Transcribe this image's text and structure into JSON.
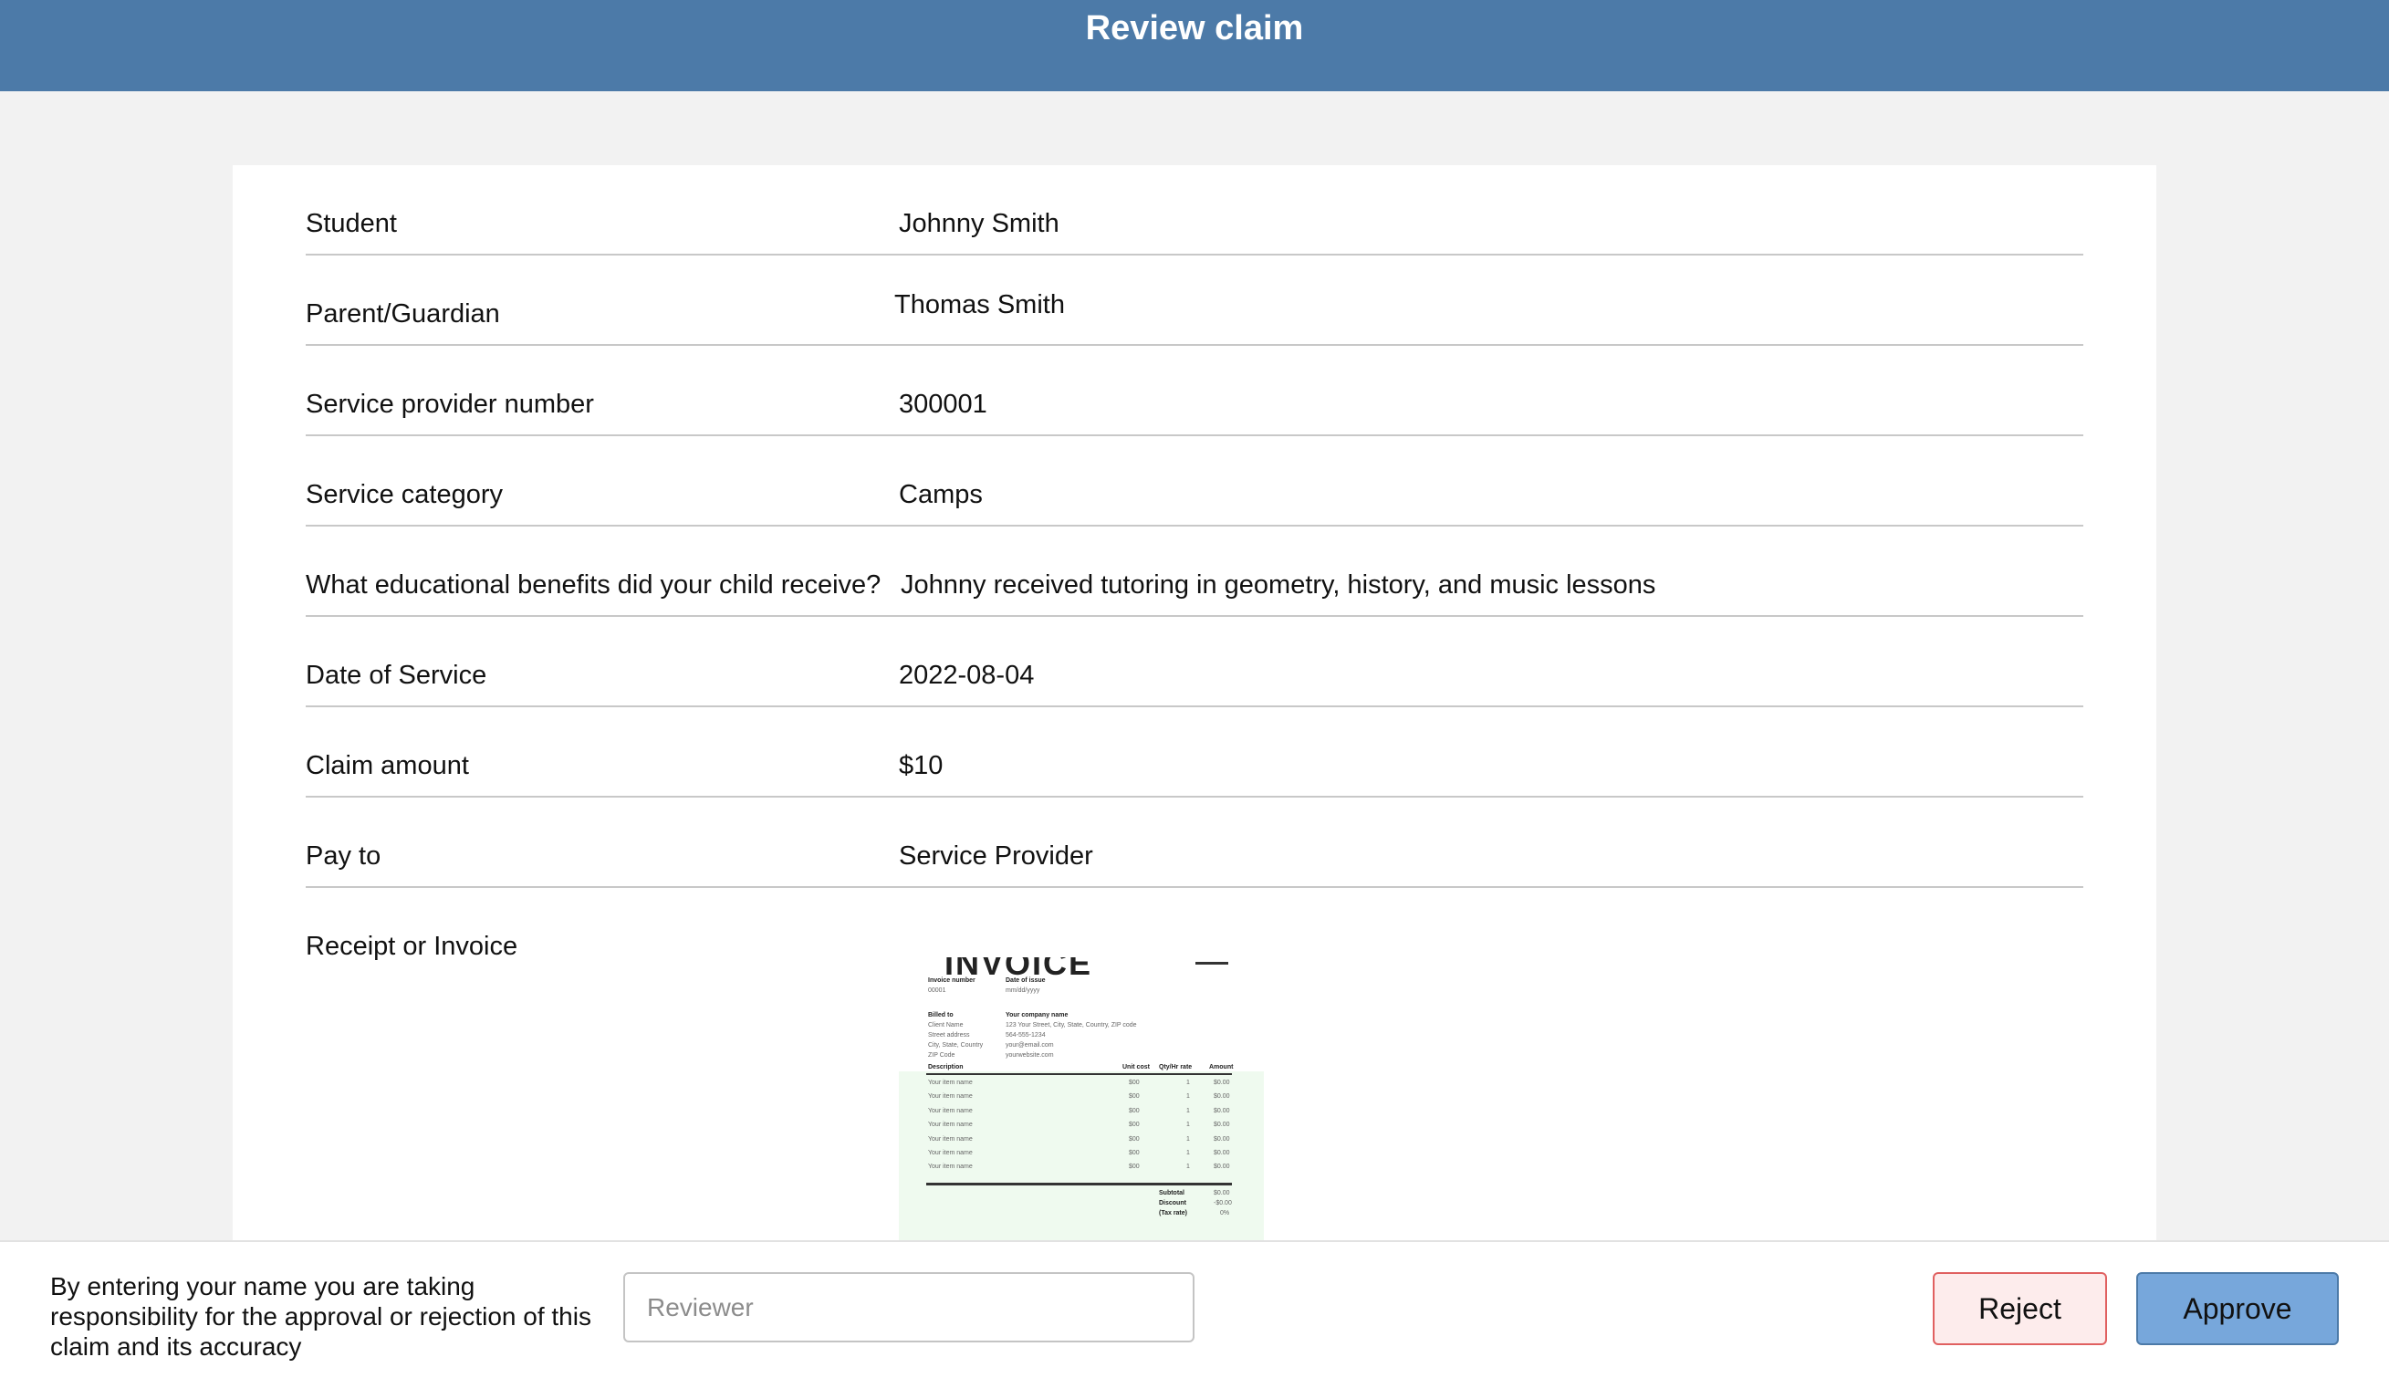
{
  "header": {
    "title": "Review claim"
  },
  "fields": [
    {
      "label": "Student",
      "value": "Johnny Smith"
    },
    {
      "label": "Parent/Guardian",
      "value": "Thomas Smith"
    },
    {
      "label": "Service provider number",
      "value": "300001"
    },
    {
      "label": "Service category",
      "value": "Camps"
    },
    {
      "label": "What educational benefits did your child receive?",
      "value": "Johnny received tutoring in geometry, history, and music lessons"
    },
    {
      "label": "Date of Service",
      "value": "2022-08-04"
    },
    {
      "label": "Claim amount",
      "value": "$10"
    },
    {
      "label": "Pay to",
      "value": "Service Provider"
    },
    {
      "label": "Receipt or Invoice"
    }
  ],
  "receipt": {
    "title": "INVOICE",
    "invoice_number_label": "Invoice number",
    "invoice_number": "00001",
    "date_label": "Date of issue",
    "date": "mm/dd/yyyy",
    "billed_to_label": "Billed to",
    "billed_to": [
      "Client Name",
      "Street address",
      "City, State, Country",
      "ZIP Code"
    ],
    "company_label": "Your company name",
    "company": [
      "123 Your Street, City, State, Country, ZIP code",
      "564-555-1234",
      "your@email.com",
      "yourwebsite.com"
    ],
    "columns": [
      "Description",
      "Unit cost",
      "Qty/Hr rate",
      "Amount"
    ],
    "items": [
      [
        "Your item name",
        "$00",
        "1",
        "$0.00"
      ],
      [
        "Your item name",
        "$00",
        "1",
        "$0.00"
      ],
      [
        "Your item name",
        "$00",
        "1",
        "$0.00"
      ],
      [
        "Your item name",
        "$00",
        "1",
        "$0.00"
      ],
      [
        "Your item name",
        "$00",
        "1",
        "$0.00"
      ],
      [
        "Your item name",
        "$00",
        "1",
        "$0.00"
      ],
      [
        "Your item name",
        "$00",
        "1",
        "$0.00"
      ]
    ],
    "totals": [
      [
        "Subtotal",
        "$0.00"
      ],
      [
        "Discount",
        "-$0.00"
      ],
      [
        "(Tax rate)",
        "0%"
      ]
    ]
  },
  "footer": {
    "disclaimer": "By entering your name you are taking responsibility for the approval or rejection of this claim and its accuracy",
    "reviewer_placeholder": "Reviewer",
    "reject_label": "Reject",
    "approve_label": "Approve"
  },
  "colors": {
    "header_bg": "#4c7aa8",
    "approve_bg": "#77a7db",
    "reject_bg": "#fdecec",
    "reject_border": "#e06060"
  }
}
